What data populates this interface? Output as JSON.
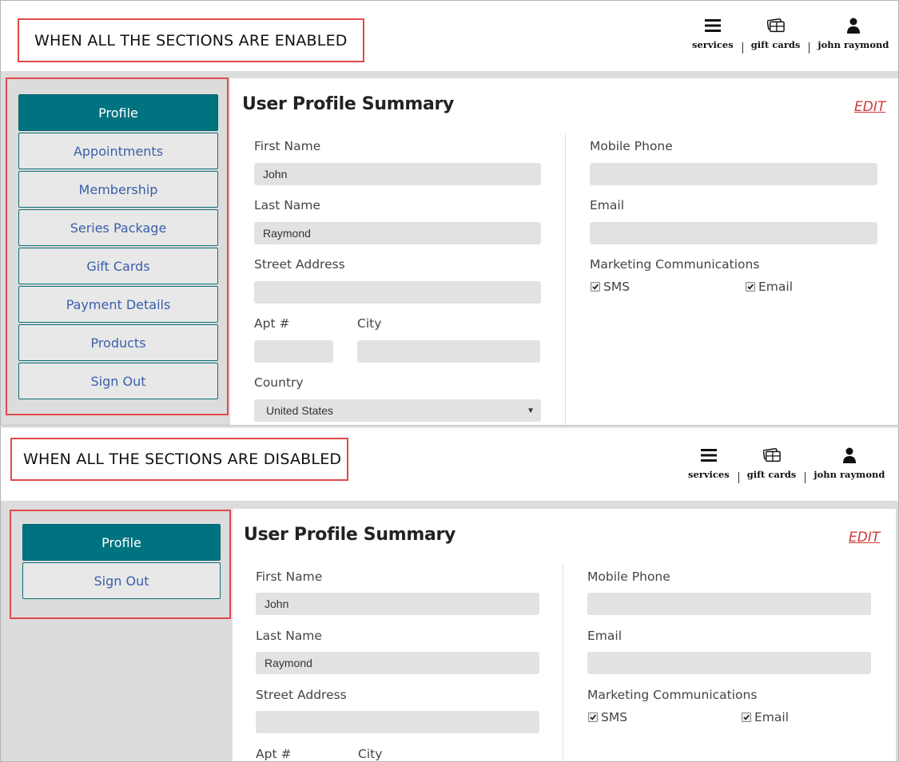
{
  "enabled_view": {
    "banner": "WHEN ALL THE SECTIONS ARE ENABLED",
    "header": {
      "services": "services",
      "gift_cards": "gift cards",
      "user": "john raymond"
    },
    "menu": [
      "Profile",
      "Appointments",
      "Membership",
      "Series Package",
      "Gift Cards",
      "Payment Details",
      "Products",
      "Sign Out"
    ],
    "title": "User Profile Summary",
    "edit": "EDIT",
    "fields": {
      "first_name_label": "First Name",
      "first_name": "John",
      "last_name_label": "Last Name",
      "last_name": "Raymond",
      "street_label": "Street Address",
      "street": "",
      "apt_label": "Apt #",
      "apt": "",
      "city_label": "City",
      "city": "",
      "country_label": "Country",
      "country": "United States",
      "mobile_label": "Mobile Phone",
      "mobile": "",
      "email_label": "Email",
      "email": "",
      "marketing_label": "Marketing Communications",
      "sms_label": "SMS",
      "sms_checked": true,
      "email_opt_label": "Email",
      "email_checked": true
    }
  },
  "disabled_view": {
    "banner": "WHEN ALL THE SECTIONS ARE DISABLED",
    "header": {
      "services": "services",
      "gift_cards": "gift cards",
      "user": "john raymond"
    },
    "menu": [
      "Profile",
      "Sign Out"
    ],
    "title": "User Profile Summary",
    "edit": "EDIT",
    "fields": {
      "first_name_label": "First Name",
      "first_name": "John",
      "last_name_label": "Last Name",
      "last_name": "Raymond",
      "street_label": "Street Address",
      "street": "",
      "apt_label": "Apt #",
      "city_label": "City",
      "mobile_label": "Mobile Phone",
      "mobile": "",
      "email_label": "Email",
      "email": "",
      "marketing_label": "Marketing Communications",
      "sms_label": "SMS",
      "sms_checked": true,
      "email_opt_label": "Email",
      "email_checked": true
    }
  },
  "colors": {
    "accent": "#007380",
    "annotation": "#e04a4a",
    "link": "#3a5fa8",
    "edit": "#d03a3a"
  },
  "icons": {
    "services": "hamburger-icon",
    "gift_cards": "gift-card-icon",
    "user": "user-icon"
  }
}
